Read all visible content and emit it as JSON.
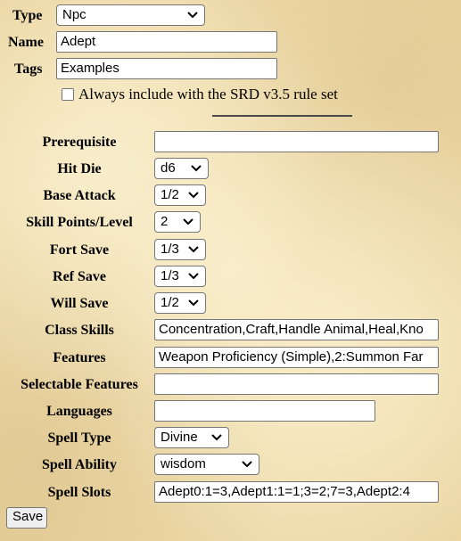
{
  "type": {
    "label": "Type",
    "value": "Npc"
  },
  "name": {
    "label": "Name",
    "value": "Adept"
  },
  "tags": {
    "label": "Tags",
    "value": "Examples"
  },
  "srd_checkbox": {
    "label": "Always include with the SRD v3.5 rule set",
    "checked": false
  },
  "fields": {
    "prerequisite": {
      "label": "Prerequisite",
      "value": ""
    },
    "hit_die": {
      "label": "Hit Die",
      "value": "d6"
    },
    "base_attack": {
      "label": "Base Attack",
      "value": "1/2"
    },
    "skill_points": {
      "label": "Skill Points/Level",
      "value": "2"
    },
    "fort_save": {
      "label": "Fort Save",
      "value": "1/3"
    },
    "ref_save": {
      "label": "Ref Save",
      "value": "1/3"
    },
    "will_save": {
      "label": "Will Save",
      "value": "1/2"
    },
    "class_skills": {
      "label": "Class Skills",
      "value": "Concentration,Craft,Handle Animal,Heal,Kno"
    },
    "features": {
      "label": "Features",
      "value": "Weapon Proficiency (Simple),2:Summon Far"
    },
    "selectable_features": {
      "label": "Selectable Features",
      "value": ""
    },
    "languages": {
      "label": "Languages",
      "value": ""
    },
    "spell_type": {
      "label": "Spell Type",
      "value": "Divine"
    },
    "spell_ability": {
      "label": "Spell Ability",
      "value": "wisdom"
    },
    "spell_slots": {
      "label": "Spell Slots",
      "value": "Adept0:1=3,Adept1:1=1;3=2;7=3,Adept2:4"
    }
  },
  "save_button": {
    "label": "Save"
  },
  "icons": {
    "dropdown": "chevron-down-icon"
  }
}
